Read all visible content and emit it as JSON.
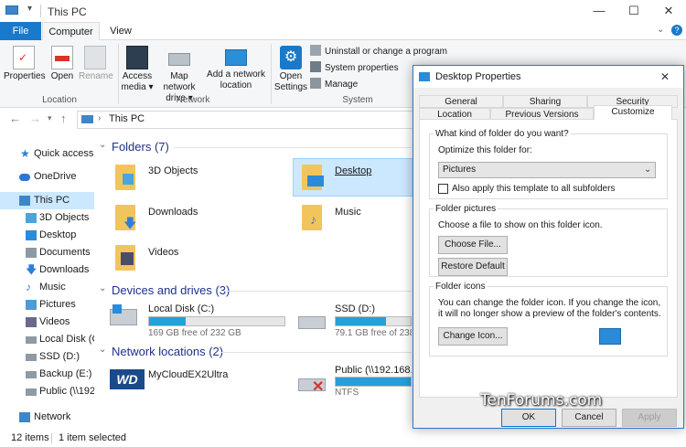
{
  "window": {
    "title": "This PC"
  },
  "ribbon": {
    "tabs": [
      "File",
      "Computer",
      "View"
    ],
    "location": {
      "label": "Location",
      "properties": "Properties",
      "open": "Open",
      "rename": "Rename"
    },
    "network": {
      "label": "Network",
      "access_media_1": "Access",
      "access_media_2": "media ▾",
      "map_drive_1": "Map network",
      "map_drive_2": "drive ▾",
      "add_loc_1": "Add a network",
      "add_loc_2": "location"
    },
    "system": {
      "label": "System",
      "open_settings_1": "Open",
      "open_settings_2": "Settings",
      "uninstall": "Uninstall or change a program",
      "sys_props": "System properties",
      "manage": "Manage"
    }
  },
  "address": {
    "path": "This PC"
  },
  "nav": {
    "items": [
      {
        "label": "Quick access",
        "icon": "star-icon",
        "color": "#2f7fd8"
      },
      {
        "label": "OneDrive",
        "icon": "cloud-icon",
        "color": "#2a76d2"
      },
      {
        "label": "This PC",
        "icon": "pc-icon",
        "color": "#3d87c8"
      },
      {
        "label": "3D Objects",
        "icon": "cube-icon",
        "color": "#49a6dc"
      },
      {
        "label": "Desktop",
        "icon": "desktop-icon",
        "color": "#2a8bd8"
      },
      {
        "label": "Documents",
        "icon": "documents-icon",
        "color": "#8d9aa6"
      },
      {
        "label": "Downloads",
        "icon": "download-icon",
        "color": "#2f7fd8"
      },
      {
        "label": "Music",
        "icon": "music-icon",
        "color": "#3a80c8"
      },
      {
        "label": "Pictures",
        "icon": "pictures-icon",
        "color": "#4e9bd6"
      },
      {
        "label": "Videos",
        "icon": "videos-icon",
        "color": "#6a6a8f"
      },
      {
        "label": "Local Disk (C:)",
        "icon": "drive-icon",
        "color": "#8f9aa5"
      },
      {
        "label": "SSD (D:)",
        "icon": "drive-icon",
        "color": "#8f9aa5"
      },
      {
        "label": "Backup (E:)",
        "icon": "drive-icon",
        "color": "#8f9aa5"
      },
      {
        "label": "Public (\\\\192.1",
        "icon": "network-drive-icon",
        "color": "#8f9aa5"
      },
      {
        "label": "Network",
        "icon": "network-icon",
        "color": "#3d87c8"
      }
    ]
  },
  "content": {
    "folders_header": "Folders (7)",
    "folders": [
      "3D Objects",
      "Desktop",
      "Downloads",
      "Music",
      "Videos"
    ],
    "devices_header": "Devices and drives (3)",
    "drives": [
      {
        "name": "Local Disk (C:)",
        "info": "169 GB free of 232 GB",
        "used": 0.27
      },
      {
        "name": "SSD (D:)",
        "info": "79.1 GB free of 238 GB",
        "used": 0.67
      }
    ],
    "network_header": "Network locations (2)",
    "network": [
      {
        "name": "MyCloudEX2Ultra",
        "info": ""
      },
      {
        "name": "Public (\\\\192.168.1.1",
        "info": "NTFS"
      }
    ]
  },
  "status": {
    "items": "12 items",
    "selected": "1 item selected"
  },
  "dialog": {
    "title": "Desktop Properties",
    "tabs_row1": [
      "General",
      "Sharing",
      "Security"
    ],
    "tabs_row2": [
      "Location",
      "Previous Versions",
      "Customize"
    ],
    "q": "What kind of folder do you want?",
    "optimize_label": "Optimize this folder for:",
    "optimize_value": "Pictures",
    "apply_subfolders": "Also apply this template to all subfolders",
    "pictures_title": "Folder pictures",
    "pictures_text": "Choose a file to show on this folder icon.",
    "choose_file": "Choose File...",
    "restore_default": "Restore Default",
    "icons_title": "Folder icons",
    "icons_text": "You can change the folder icon. If you change the icon, it will no longer show a preview of the folder's contents.",
    "change_icon": "Change Icon...",
    "ok": "OK",
    "cancel": "Cancel",
    "apply": "Apply"
  },
  "watermark": "TenForums.com",
  "colors": {
    "accent": "#1979ca",
    "selection": "#cce8ff",
    "drive_fill": "#26a0da",
    "section_header": "#1e3287"
  }
}
